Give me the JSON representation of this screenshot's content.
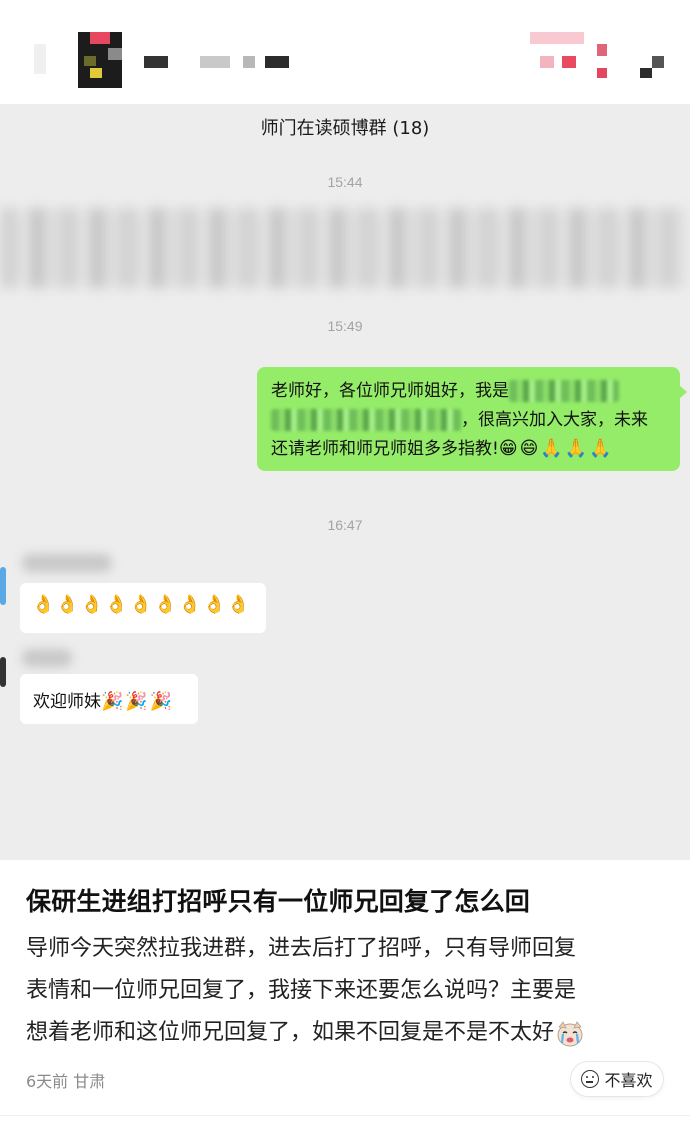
{
  "chat": {
    "group_title": "师门在读硕博群 (18)",
    "timestamps": [
      "15:44",
      "15:49",
      "16:47"
    ],
    "my_message": {
      "line1_prefix": "老师好，各位师兄师姐好，我是",
      "line2_suffix": "，很高兴加入大家，未来",
      "line3": "还请老师和师兄师姐多多指教!",
      "emojis": [
        "😁",
        "😄",
        "🙏",
        "🙏",
        "🙏"
      ]
    },
    "reply1": {
      "emojis": [
        "👌",
        "👌",
        "👌",
        "👌",
        "👌",
        "👌",
        "👌",
        "👌",
        "👌"
      ]
    },
    "reply2": {
      "text": "欢迎师妹",
      "emojis": [
        "🎉",
        "🎉",
        "🎉"
      ]
    }
  },
  "post": {
    "title": "保研生进组打招呼只有一位师兄回复了怎么回",
    "body_line1": "导师今天突然拉我进群，进去后打了招呼，只有导师回复",
    "body_line2": "表情和一位师兄回复了，我接下来还要怎么说吗？主要是",
    "body_line3": "想着老师和这位师兄回复了，如果不回复是不是不太好",
    "meta": "6天前 甘肃",
    "dislike_label": "不喜欢"
  },
  "colors": {
    "chat_bg": "#ededed",
    "my_bubble": "#95ec69",
    "other_bubble": "#ffffff",
    "accent_pink": "#e33a54"
  },
  "icons": {
    "dislike": "unhappy-face-icon",
    "crying": "crying-dog-icon"
  }
}
